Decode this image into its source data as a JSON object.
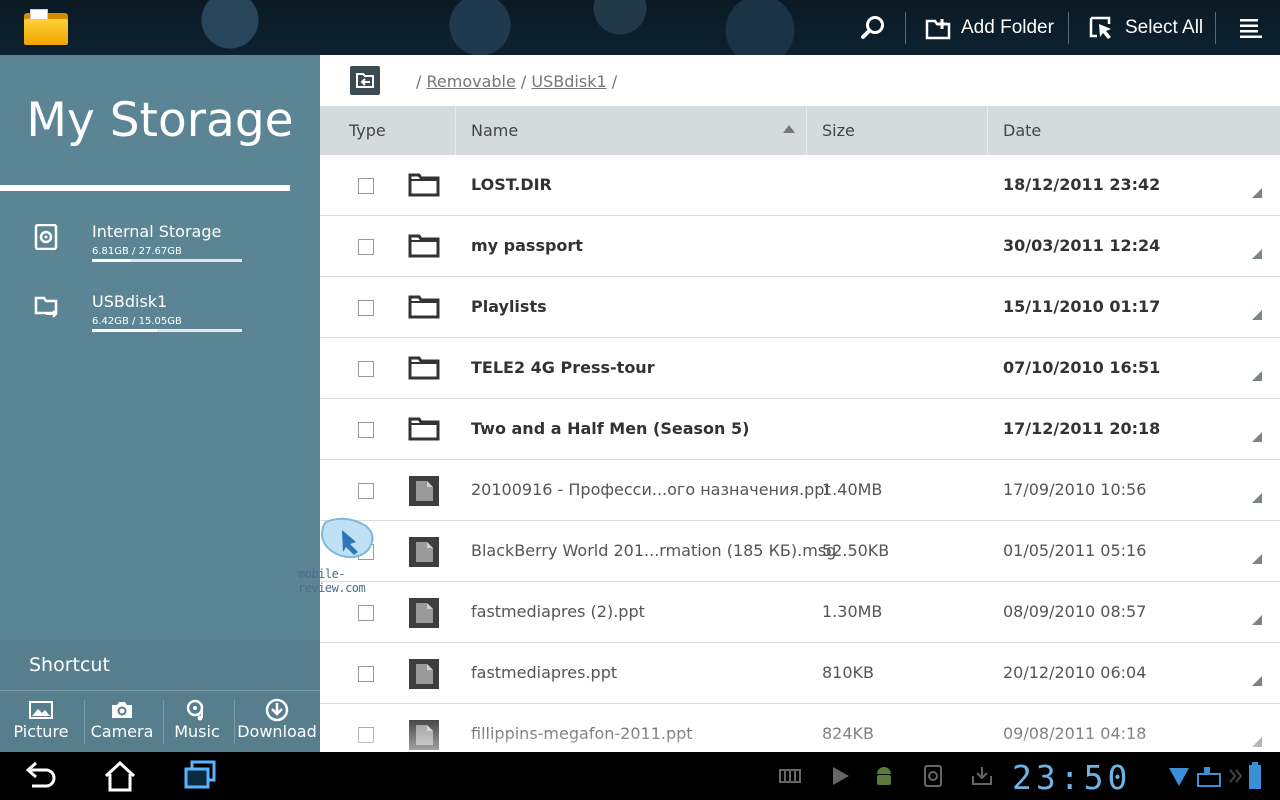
{
  "topbar": {
    "actions": {
      "search_label": "",
      "add_folder_label": "Add Folder",
      "select_all_label": "Select All"
    }
  },
  "sidebar": {
    "title": "My Storage",
    "storages": [
      {
        "name": "Internal Storage",
        "capacity": "6.81GB / 27.67GB",
        "used_fraction": 0.25
      },
      {
        "name": "USBdisk1",
        "capacity": "6.42GB / 15.05GB",
        "used_fraction": 0.43
      }
    ],
    "shortcut": {
      "title": "Shortcut",
      "items": [
        {
          "label": "Picture"
        },
        {
          "label": "Camera"
        },
        {
          "label": "Music"
        },
        {
          "label": "Download"
        }
      ]
    }
  },
  "breadcrumb": {
    "sep": "/",
    "parts": [
      "Removable",
      "USBdisk1"
    ]
  },
  "table": {
    "columns": {
      "type": "Type",
      "name": "Name",
      "size": "Size",
      "date": "Date"
    },
    "rows": [
      {
        "kind": "folder",
        "name": "LOST.DIR",
        "size": "",
        "date": "18/12/2011 23:42"
      },
      {
        "kind": "folder",
        "name": "my passport",
        "size": "",
        "date": "30/03/2011 12:24"
      },
      {
        "kind": "folder",
        "name": "Playlists",
        "size": "",
        "date": "15/11/2010 01:17"
      },
      {
        "kind": "folder",
        "name": "TELE2 4G Press-tour",
        "size": "",
        "date": "07/10/2010 16:51"
      },
      {
        "kind": "folder",
        "name": "Two and a Half Men (Season 5)",
        "size": "",
        "date": "17/12/2011 20:18"
      },
      {
        "kind": "file",
        "name": "20100916 - Професси...ого назначения.ppt",
        "size": "1.40MB",
        "date": "17/09/2010 10:56"
      },
      {
        "kind": "file",
        "name": "BlackBerry World 201...rmation (185 КБ).msg",
        "size": "52.50KB",
        "date": "01/05/2011 05:16"
      },
      {
        "kind": "file",
        "name": "fastmediapres (2).ppt",
        "size": "1.30MB",
        "date": "08/09/2010 08:57"
      },
      {
        "kind": "file",
        "name": "fastmediapres.ppt",
        "size": "810KB",
        "date": "20/12/2010 06:04"
      },
      {
        "kind": "file",
        "name": "fillippins-megafon-2011.ppt",
        "size": "824KB",
        "date": "09/08/2011 04:18"
      }
    ]
  },
  "watermark": {
    "text": "mobile-review.com"
  },
  "system": {
    "clock": "23:50"
  },
  "colors": {
    "sidebar": "#5b8594",
    "header": "#d5dadc",
    "clock": "#6fb3e4"
  }
}
